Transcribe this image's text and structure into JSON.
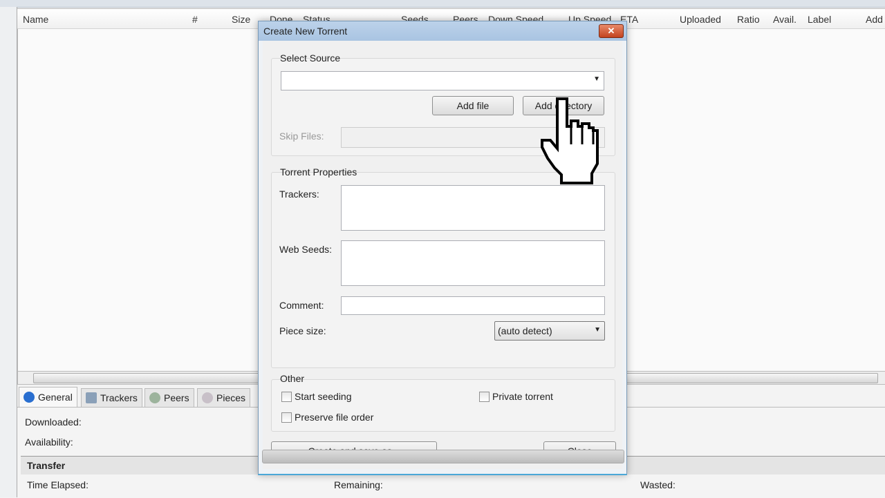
{
  "columns": [
    "Name",
    "#",
    "Size",
    "Done",
    "Status",
    "Seeds",
    "Peers",
    "Down Speed",
    "Up Speed",
    "ETA",
    "Uploaded",
    "Ratio",
    "Avail.",
    "Label",
    "Add"
  ],
  "tabs": [
    {
      "label": "General",
      "icon": "info-icon"
    },
    {
      "label": "Trackers",
      "icon": "trackers-icon"
    },
    {
      "label": "Peers",
      "icon": "peers-icon"
    },
    {
      "label": "Pieces",
      "icon": "pieces-icon"
    }
  ],
  "general": {
    "downloaded": "Downloaded:",
    "availability": "Availability:",
    "transfer": "Transfer",
    "time_elapsed": "Time Elapsed:",
    "remaining": "Remaining:",
    "wasted": "Wasted:"
  },
  "dialog": {
    "title": "Create New Torrent",
    "close_icon": "✕",
    "select_source": "Select Source",
    "source_value": "",
    "add_file": "Add file",
    "add_directory": "Add directory",
    "skip_files": "Skip Files:",
    "torrent_properties": "Torrent Properties",
    "trackers": "Trackers:",
    "web_seeds": "Web Seeds:",
    "comment": "Comment:",
    "piece_size": "Piece size:",
    "piece_size_value": "(auto detect)",
    "other": "Other",
    "start_seeding": "Start seeding",
    "private_torrent": "Private torrent",
    "preserve_file_order": "Preserve file order",
    "create_save": "Create and save as...",
    "close": "Close",
    "checked": {
      "start_seeding": false,
      "private_torrent": false,
      "preserve_file_order": false
    }
  }
}
